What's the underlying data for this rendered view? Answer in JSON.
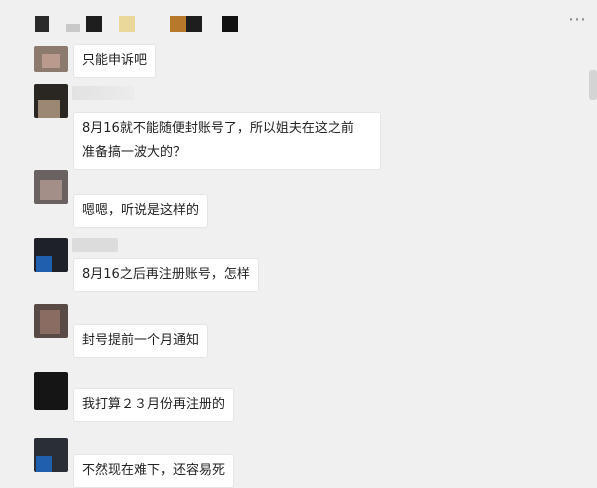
{
  "header": {
    "more_icon": "more-horizontal-icon",
    "more_glyph": "⋯"
  },
  "messages": [
    {
      "text": "只能申诉吧"
    },
    {
      "text_lines": [
        "8月16就不能随便封账号了，所以姐夫在这之前",
        "准备搞一波大的？"
      ]
    },
    {
      "text": "嗯嗯，听说是这样的"
    },
    {
      "text": "8月16之后再注册账号，怎样"
    },
    {
      "text": "封号提前一个月通知"
    },
    {
      "text": "我打算２３月份再注册的"
    },
    {
      "text": "不然现在难下，还容易死"
    }
  ],
  "colors": {
    "background": "#f0f0f0",
    "bubble": "#ffffff",
    "text": "#222222"
  }
}
